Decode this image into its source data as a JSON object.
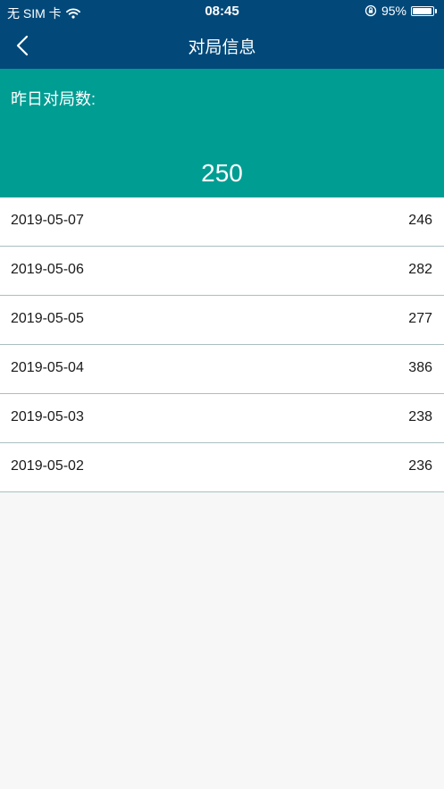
{
  "status_bar": {
    "carrier": "无 SIM 卡",
    "time": "08:45",
    "battery_percent": "95%",
    "battery_level": 0.95
  },
  "nav": {
    "title": "对局信息",
    "back_icon": "chevron-left-icon"
  },
  "summary": {
    "label": "昨日对局数:",
    "value": "250"
  },
  "records": [
    {
      "date": "2019-05-07",
      "count": "246"
    },
    {
      "date": "2019-05-06",
      "count": "282"
    },
    {
      "date": "2019-05-05",
      "count": "277"
    },
    {
      "date": "2019-05-04",
      "count": "386"
    },
    {
      "date": "2019-05-03",
      "count": "238"
    },
    {
      "date": "2019-05-02",
      "count": "236"
    }
  ],
  "colors": {
    "nav_background": "#02497a",
    "summary_background": "#009d93",
    "divider": "#a9bfc1",
    "page_background": "#f7f7f7"
  }
}
